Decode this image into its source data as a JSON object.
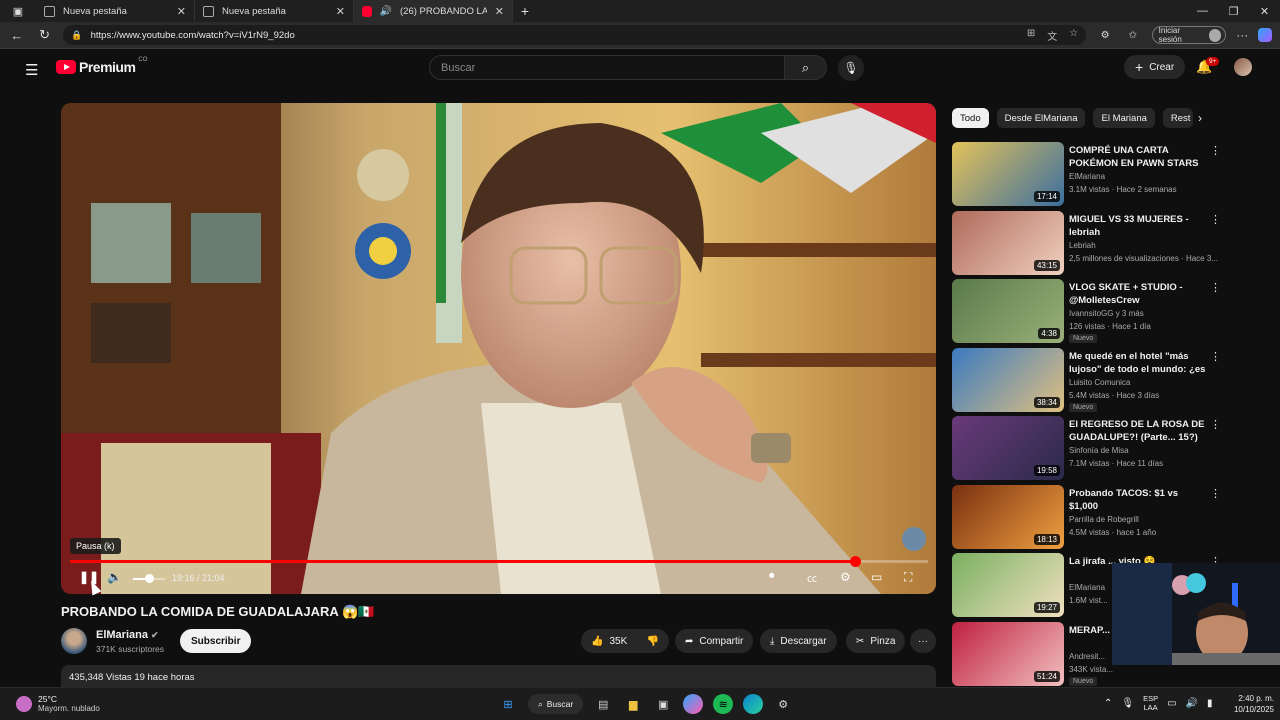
{
  "browser": {
    "tabs": [
      {
        "label": "Nueva pestaña"
      },
      {
        "label": "Nueva pestaña"
      },
      {
        "label": "(26) PROBANDO LA COMIDA"
      }
    ],
    "url": "https://www.youtube.com/watch?v=iV1rN9_92do",
    "signin_label": "Iniciar sesión"
  },
  "youtube": {
    "brand": "Premium",
    "region": "CO",
    "search_placeholder": "Buscar",
    "create_label": "Crear",
    "notifications_badge": "9+"
  },
  "player": {
    "tooltip": "Pausa (k)",
    "time": "19:16 / 21:04",
    "progress_fraction": 0.915,
    "volume_fraction": 0.5
  },
  "video": {
    "title": "PROBANDO LA COMIDA DE GUADALAJARA 😱🇲🇽",
    "channel": "ElMariana",
    "subscribers": "371K suscriptores",
    "subscribe_label": "Subscribir",
    "likes": "35K",
    "share_label": "Compartir",
    "download_label": "Descargar",
    "clip_label": "Pinza",
    "description_stats": "435,348 Vistas 19 hace horas"
  },
  "sidebar": {
    "chips": [
      "Todo",
      "Desde ElMariana",
      "El Mariana",
      "Rest"
    ],
    "recommendations": [
      {
        "title": "COMPRÉ UNA CARTA POKÉMON EN PAWN STARS 😱",
        "channel": "ElMariana",
        "meta": "3.1M vistas · Hace 2 semanas",
        "duration": "17:14",
        "nuevo": ""
      },
      {
        "title": "MIGUEL VS 33 MUJERES - lebriah",
        "channel": "Lebriah",
        "meta": "2,5 millones de visualizaciones · Hace 3...",
        "duration": "43:15",
        "nuevo": ""
      },
      {
        "title": "VLOG SKATE + STUDIO - @MolletesCrew",
        "channel": "IvannsitoGG y 3 más",
        "meta": "126 vistas · Hace 1 día",
        "duration": "4:38",
        "nuevo": "Nuevo"
      },
      {
        "title": "Me quedé en el hotel \"más lujoso\" de todo el mundo: ¿es ...",
        "channel": "Luisito Comunica",
        "meta": "5.4M vistas · Hace 3 días",
        "duration": "38:34",
        "nuevo": "Nuevo"
      },
      {
        "title": "El REGRESO DE LA ROSA DE GUADALUPE?! (Parte... 15?)",
        "channel": "Sinfonía de Misa",
        "meta": "7.1M vistas · Hace 11 días",
        "duration": "19:58",
        "nuevo": ""
      },
      {
        "title": "Probando TACOS: $1 vs $1,000",
        "channel": "Parrilla de Robegrill",
        "meta": "4.5M vistas · hace 1 año",
        "duration": "18:13",
        "nuevo": ""
      },
      {
        "title": "La jirafa ... visto 😵",
        "channel": "ElMariana",
        "meta": "1.6M vist...",
        "duration": "19:27",
        "nuevo": ""
      },
      {
        "title": "MERAP...",
        "channel": "Andresit...",
        "meta": "343K vista...",
        "duration": "51:24",
        "nuevo": "Nuevo"
      }
    ]
  },
  "taskbar": {
    "temperature": "25°C",
    "condition": "Mayorm. nublado",
    "search_label": "Buscar",
    "lang_line1": "ESP",
    "lang_line2": "LAA",
    "time": "2:40 p. m.",
    "date": "10/10/2025"
  }
}
